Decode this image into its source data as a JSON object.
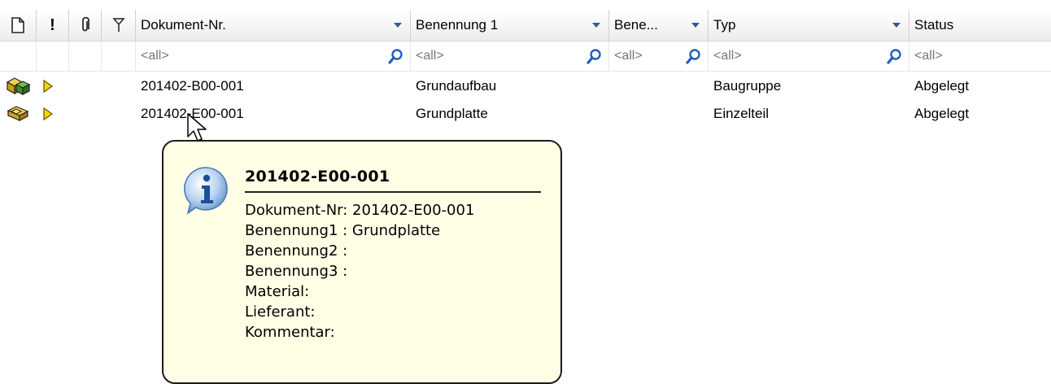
{
  "columns": [
    {
      "key": "doc",
      "label": "",
      "icon": "document-icon"
    },
    {
      "key": "prio",
      "label": "!",
      "icon": "priority-icon"
    },
    {
      "key": "attach",
      "label": "",
      "icon": "paperclip-icon"
    },
    {
      "key": "flag",
      "label": "",
      "icon": "flag-icon"
    },
    {
      "key": "doknr",
      "label": "Dokument-Nr.",
      "filter_placeholder": "<all>"
    },
    {
      "key": "ben1",
      "label": "Benennung 1",
      "filter_placeholder": "<all>"
    },
    {
      "key": "ben",
      "label": "Bene...",
      "filter_placeholder": "<all>"
    },
    {
      "key": "typ",
      "label": "Typ",
      "filter_placeholder": "<all>"
    },
    {
      "key": "status",
      "label": "Status",
      "filter_placeholder": "<all>"
    }
  ],
  "rows": [
    {
      "icon": "assembly-icon",
      "marker": "play-arrow-icon",
      "doknr": "201402-B00-001",
      "ben1": "Grundaufbau",
      "ben": "",
      "typ": "Baugruppe",
      "status": "Abgelegt"
    },
    {
      "icon": "part-icon",
      "marker": "play-arrow-icon",
      "doknr": "201402-E00-001",
      "ben1": "Grundplatte",
      "ben": "",
      "typ": "Einzelteil",
      "status": "Abgelegt"
    }
  ],
  "tooltip": {
    "icon": "info-icon",
    "title": "201402-E00-001",
    "lines": [
      "Dokument-Nr: 201402-E00-001",
      "Benennung1 : Grundplatte",
      "Benennung2 :",
      "Benennung3 :",
      "Material:",
      "Lieferant:",
      "Kommentar:"
    ]
  },
  "colors": {
    "tooltip_bg": "#ffffe6",
    "filter_icon": "#1f5fbf",
    "marker_yellow": "#f2d400"
  }
}
